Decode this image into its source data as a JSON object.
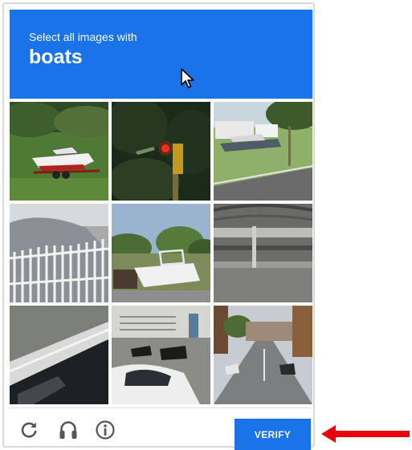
{
  "challenge": {
    "prompt": "Select all images with",
    "target": "boats"
  },
  "tiles": [
    {
      "row": 1,
      "col": 1,
      "icon": "boat-on-trailer-image"
    },
    {
      "row": 1,
      "col": 2,
      "icon": "traffic-light-image"
    },
    {
      "row": 1,
      "col": 3,
      "icon": "boat-on-trailer-image"
    },
    {
      "row": 2,
      "col": 1,
      "icon": "fence-image"
    },
    {
      "row": 2,
      "col": 2,
      "icon": "boat-in-yard-image"
    },
    {
      "row": 2,
      "col": 3,
      "icon": "parking-garage-image"
    },
    {
      "row": 3,
      "col": 1,
      "icon": "car-roof-image"
    },
    {
      "row": 3,
      "col": 2,
      "icon": "motorcycles-image"
    },
    {
      "row": 3,
      "col": 3,
      "icon": "street-image"
    }
  ],
  "footer": {
    "verify_label": "VERIFY",
    "icons": [
      "reload-icon",
      "audio-challenge-icon",
      "info-icon"
    ]
  },
  "colors": {
    "accent": "#1a73e8",
    "annotation_arrow": "#e8000b"
  }
}
